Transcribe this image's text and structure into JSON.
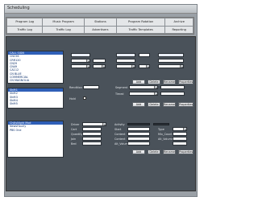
{
  "window": {
    "title": "Scheduling"
  },
  "toolbar": {
    "tabs_row1": [
      "Program Log",
      "Music Program",
      "Stations",
      "Program Rotation",
      "Archive"
    ],
    "tabs_row2": [
      "Traffic Log",
      "Traffic Log",
      "Advertisers",
      "Traffic Templates",
      "Reporting"
    ]
  },
  "top_list": {
    "items": [
      "CALL SIGN",
      "CNC56",
      "CRR120",
      "CN29",
      "CN49",
      "CA112",
      "CN BLUE",
      "COMMERCIAL",
      "CN MAGNOLIA",
      "COMMERCIAL 1",
      "ABCDE FGH",
      "AIR",
      "ALL LOGS",
      "BACKUP"
    ],
    "selected": 0
  },
  "mid_list": {
    "items": [
      "Shift1",
      "Shift2",
      "Shift3",
      "Shift4",
      "Shift5"
    ],
    "selected": 0
  },
  "bottom_list": {
    "items": [
      "ChillsNight Mod",
      "NewsHourly",
      "PBS One"
    ],
    "selected": 0
  },
  "top_form": {
    "buttons": [
      "Add",
      "Delete",
      "Rename",
      "Properties"
    ]
  },
  "mid_form": {
    "labels": [
      "Rendition",
      "Hold",
      "Segment",
      "Timed"
    ],
    "buttons": [
      "Add",
      "Delete",
      "Rename",
      "Properties"
    ]
  },
  "bottom_form": {
    "labels_col1": [
      "Driver",
      "Cart",
      "Quantity",
      "Join",
      "Bed"
    ],
    "labels_col2": [
      "Activity",
      "Start",
      "Content",
      "Content",
      "Alt_Volume"
    ],
    "labels_col3": [
      "Type",
      "Mix_Count",
      "Alt_Volume"
    ],
    "buttons": [
      "Add",
      "Delete",
      "Rename",
      "Properties"
    ]
  }
}
